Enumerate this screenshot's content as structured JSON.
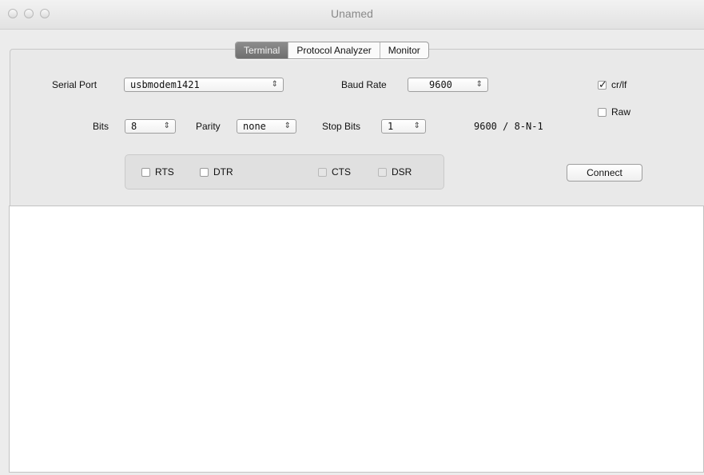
{
  "window": {
    "title": "Unamed"
  },
  "tabs": [
    {
      "label": "Terminal",
      "active": true
    },
    {
      "label": "Protocol Analyzer",
      "active": false
    },
    {
      "label": "Monitor",
      "active": false
    }
  ],
  "settings": {
    "serial_port_label": "Serial Port",
    "serial_port_value": "usbmodem1421",
    "baud_rate_label": "Baud Rate",
    "baud_rate_value": "9600",
    "bits_label": "Bits",
    "bits_value": "8",
    "parity_label": "Parity",
    "parity_value": "none",
    "stop_bits_label": "Stop Bits",
    "stop_bits_value": "1",
    "summary": "9600 / 8-N-1",
    "popup_arrow": "⇕"
  },
  "options": {
    "crlf_label": "cr/lf",
    "crlf_checked": true,
    "raw_label": "Raw",
    "raw_checked": false
  },
  "signals": {
    "rts_label": "RTS",
    "dtr_label": "DTR",
    "cts_label": "CTS",
    "dsr_label": "DSR"
  },
  "connect_label": "Connect",
  "colors": {
    "window_bg": "#ececec",
    "active_tab": "#7a7a7a",
    "terminal_bg": "#ffffff"
  }
}
